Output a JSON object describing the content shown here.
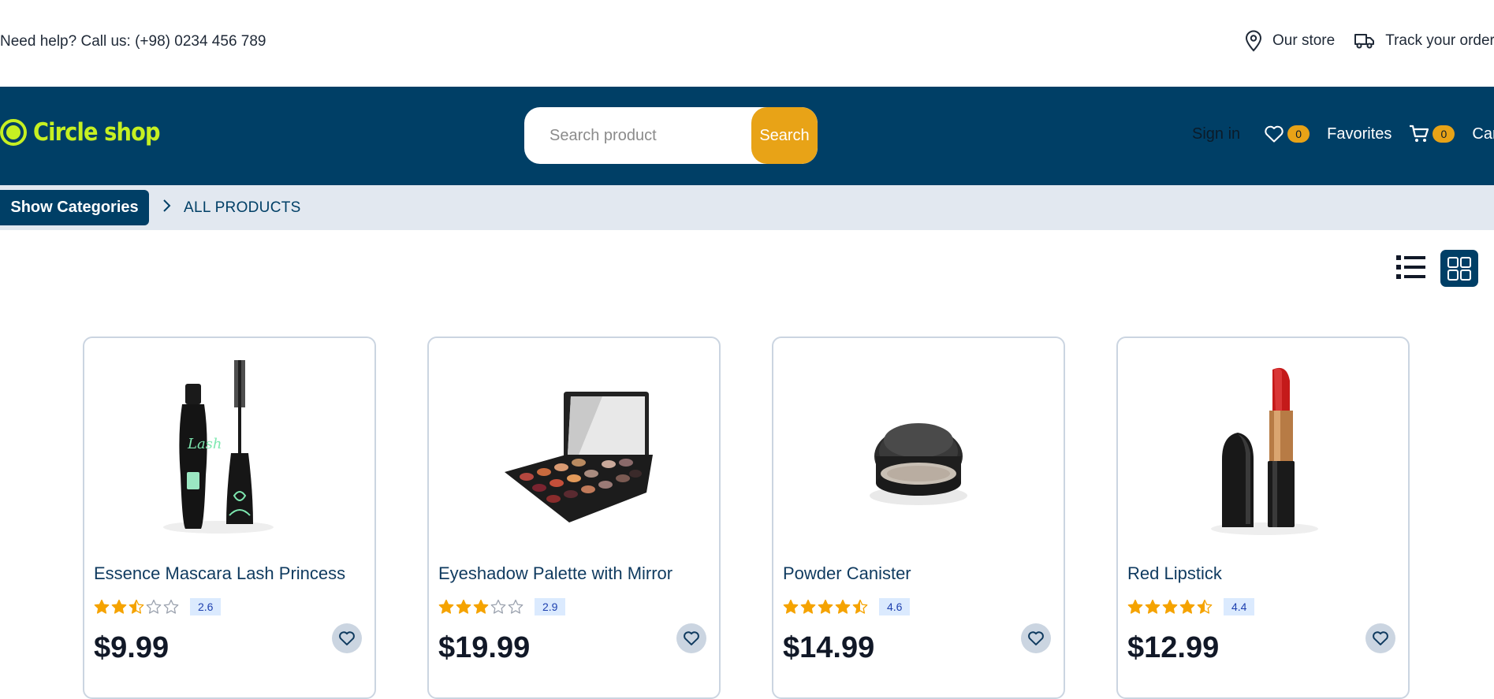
{
  "topbar": {
    "help_text": "Need help? Call us: (+98) 0234 456 789",
    "our_store": "Our store",
    "track_order": "Track your order"
  },
  "header": {
    "logo_text": "Circle shop",
    "search_placeholder": "Search product",
    "search_button": "Search",
    "sign_in": "Sign in",
    "favorites_count": "0",
    "favorites_label": "Favorites",
    "cart_count": "0",
    "cart_label": "Cart"
  },
  "breadcrumb": {
    "show_categories": "Show Categories",
    "current": "ALL PRODUCTS"
  },
  "colors": {
    "primary": "#003f66",
    "accent": "#e8a317",
    "logo": "#c6f022",
    "star": "#f5a300"
  },
  "products": [
    {
      "title": "Essence Mascara Lash Princess",
      "rating": "2.6",
      "rating_value": 2.6,
      "price": "$9.99",
      "image": "mascara"
    },
    {
      "title": "Eyeshadow Palette with Mirror",
      "rating": "2.9",
      "rating_value": 2.9,
      "price": "$19.99",
      "image": "eyeshadow-palette"
    },
    {
      "title": "Powder Canister",
      "rating": "4.6",
      "rating_value": 4.6,
      "price": "$14.99",
      "image": "powder-canister"
    },
    {
      "title": "Red Lipstick",
      "rating": "4.4",
      "rating_value": 4.4,
      "price": "$12.99",
      "image": "red-lipstick"
    }
  ]
}
